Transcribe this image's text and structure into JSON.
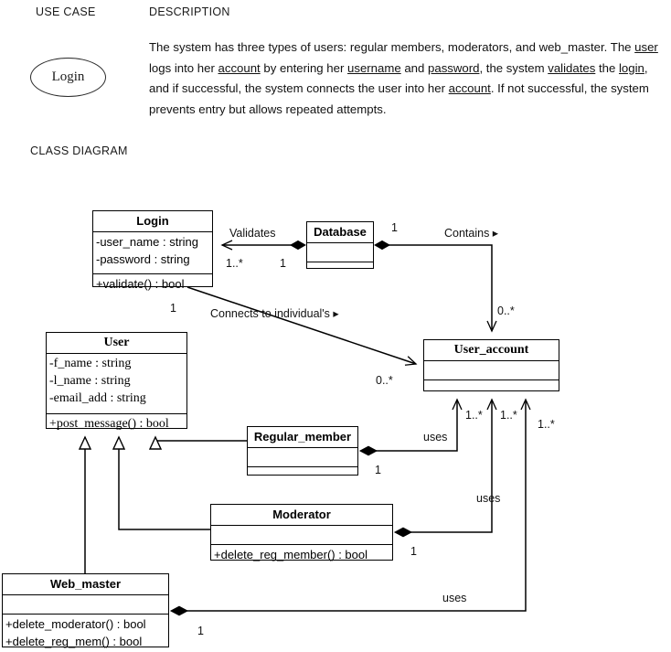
{
  "use_case_table": {
    "headers": {
      "use_case": "USE CASE",
      "description": "DESCRIPTION"
    },
    "row": {
      "use_case_name": "Login",
      "description_segments": [
        {
          "text": "The system has three types of users: regular members, moderators, and web_master. The ",
          "underline": false
        },
        {
          "text": "user",
          "underline": true
        },
        {
          "text": " logs into her ",
          "underline": false
        },
        {
          "text": "account",
          "underline": true
        },
        {
          "text": " by entering her ",
          "underline": false
        },
        {
          "text": "username",
          "underline": true
        },
        {
          "text": " and ",
          "underline": false
        },
        {
          "text": "password",
          "underline": true
        },
        {
          "text": ", the system ",
          "underline": false
        },
        {
          "text": "validates",
          "underline": true
        },
        {
          "text": " the ",
          "underline": false
        },
        {
          "text": "login",
          "underline": true
        },
        {
          "text": ", and if successful, the system connects the user into her ",
          "underline": false
        },
        {
          "text": "account",
          "underline": true
        },
        {
          "text": ". If not successful, the system prevents entry but allows repeated attempts.",
          "underline": false
        }
      ]
    }
  },
  "class_diagram": {
    "section_label": "CLASS DIAGRAM",
    "classes": {
      "login": {
        "name": "Login",
        "attributes": [
          "-user_name : string",
          "-password : string"
        ],
        "operations": [
          "+validate() : bool"
        ]
      },
      "database": {
        "name": "Database",
        "attributes": [],
        "operations": []
      },
      "user": {
        "name": "User",
        "attributes": [
          "-f_name : string",
          "-l_name : string",
          "-email_add : string"
        ],
        "operations": [
          "+post_message() : bool"
        ]
      },
      "user_account": {
        "name": "User_account",
        "attributes": [],
        "operations": []
      },
      "regular_member": {
        "name": "Regular_member",
        "attributes": [],
        "operations": []
      },
      "moderator": {
        "name": "Moderator",
        "attributes": [],
        "operations": [
          "+delete_reg_member() : bool"
        ]
      },
      "web_master": {
        "name": "Web_master",
        "attributes": [],
        "operations": [
          "+delete_moderator() : bool",
          "+delete_reg_mem() : bool"
        ]
      }
    },
    "relationships": [
      {
        "id": "validates",
        "label": "Validates",
        "from": "database",
        "to": "login",
        "from_multiplicity": "1",
        "to_multiplicity": "1..*",
        "from_end": "filled-diamond",
        "to_end": "open-arrow"
      },
      {
        "id": "contains",
        "label": "Contains ▸",
        "from": "database",
        "to": "user_account",
        "from_multiplicity": "1",
        "to_multiplicity": "0..*",
        "from_end": "filled-diamond",
        "to_end": "open-arrow"
      },
      {
        "id": "connects-to-individuals",
        "label": "Connects to individual's ▸",
        "from": "login",
        "to": "user_account",
        "from_multiplicity": "1",
        "to_multiplicity": "0..*",
        "from_end": "plain",
        "to_end": "open-arrow"
      },
      {
        "id": "regular-member-uses",
        "label": "uses",
        "from": "regular_member",
        "to": "user_account",
        "from_multiplicity": "1",
        "to_multiplicity": "1..*",
        "from_end": "filled-diamond",
        "to_end": "open-arrow"
      },
      {
        "id": "moderator-uses",
        "label": "uses",
        "from": "moderator",
        "to": "user_account",
        "from_multiplicity": "1",
        "to_multiplicity": "1..*",
        "from_end": "filled-diamond",
        "to_end": "open-arrow"
      },
      {
        "id": "web-master-uses",
        "label": "uses",
        "from": "web_master",
        "to": "user_account",
        "from_multiplicity": "1",
        "to_multiplicity": "1..*",
        "from_end": "filled-diamond",
        "to_end": "open-arrow"
      },
      {
        "id": "regular-member-inherits-user",
        "label": "",
        "from": "regular_member",
        "to": "user",
        "from_end": "plain",
        "to_end": "hollow-triangle"
      },
      {
        "id": "moderator-inherits-user",
        "label": "",
        "from": "moderator",
        "to": "user",
        "from_end": "plain",
        "to_end": "hollow-triangle"
      },
      {
        "id": "web-master-inherits-user",
        "label": "",
        "from": "web_master",
        "to": "user",
        "from_end": "plain",
        "to_end": "hollow-triangle"
      }
    ],
    "edge_labels": {
      "validates": "Validates",
      "validates_mult_login": "1..*",
      "validates_mult_database": "1",
      "contains": "Contains ▸",
      "contains_mult_database": "1",
      "contains_mult_user_account": "0..*",
      "connects": "Connects to individual's ▸",
      "connects_mult_login": "1",
      "connects_mult_user_account": "0..*",
      "uses_regular": "uses",
      "uses_regular_mult_src": "1",
      "uses_regular_mult_dst": "1..*",
      "uses_moderator": "uses",
      "uses_moderator_mult_src": "1",
      "uses_moderator_mult_dst": "1..*",
      "uses_webmaster": "uses",
      "uses_webmaster_mult_src": "1",
      "uses_webmaster_mult_dst": "1..*"
    }
  },
  "colors": {
    "stroke": "#000000",
    "text": "#111111",
    "background": "#ffffff"
  }
}
